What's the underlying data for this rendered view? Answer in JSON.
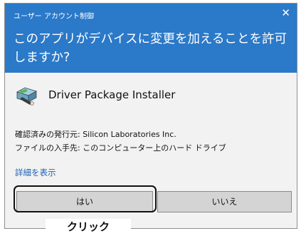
{
  "dialog": {
    "window_title": "ユーザー アカウント制御",
    "close_glyph": "✕",
    "question": "このアプリがデバイスに変更を加えることを許可しますか?",
    "header_color": "#2b79c9"
  },
  "app": {
    "name": "Driver Package Installer",
    "icon": "driver-package-icon"
  },
  "info": {
    "publisher": "確認済みの発行元: Silicon Laboratories Inc.",
    "origin": "ファイルの入手先: このコンピューター上のハード ドライブ"
  },
  "details_link": "詳細を表示",
  "buttons": {
    "yes": "はい",
    "no": "いいえ"
  },
  "annotation": {
    "callout": "クリック"
  }
}
